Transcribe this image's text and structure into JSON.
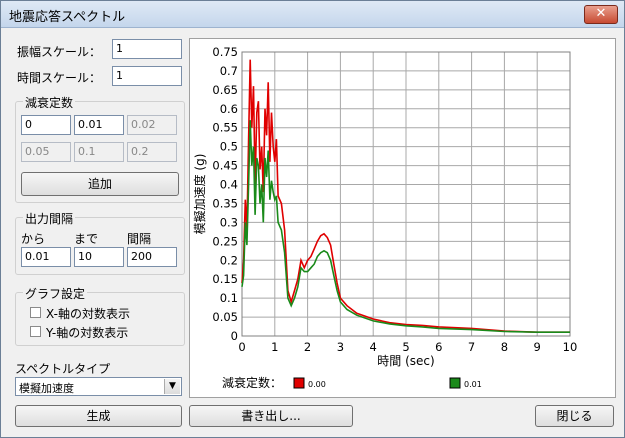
{
  "window": {
    "title": "地震応答スペクトル",
    "close_glyph": "✕"
  },
  "fields": {
    "amp_scale_label": "振幅スケール：",
    "amp_scale_value": "1",
    "time_scale_label": "時間スケール：",
    "time_scale_value": "1"
  },
  "damping": {
    "group_label": "減衰定数",
    "values": [
      "0",
      "0.01",
      "0.02",
      "0.05",
      "0.1",
      "0.2"
    ],
    "add_label": "追加"
  },
  "output": {
    "group_label": "出力間隔",
    "from_label": "から",
    "to_label": "まで",
    "interval_label": "間隔",
    "from_value": "0.01",
    "to_value": "10",
    "interval_value": "200"
  },
  "graph": {
    "group_label": "グラフ設定",
    "x_log_label": "X-軸の対数表示",
    "y_log_label": "Y-軸の対数表示"
  },
  "spectrum": {
    "type_label": "スペクトルタイプ",
    "type_value": "模擬加速度"
  },
  "buttons": {
    "generate": "生成",
    "export": "書き出し...",
    "close": "閉じる"
  },
  "legend": {
    "label": "減衰定数："
  },
  "colors": {
    "series_red": "#e00000",
    "series_green": "#1a8a1a",
    "grid": "#a8a8a8"
  },
  "chart_data": {
    "type": "line",
    "xlabel": "時間 (sec)",
    "ylabel": "模擬加速度 (g)",
    "xlim": [
      0,
      10
    ],
    "ylim": [
      0,
      0.75
    ],
    "x_ticks": [
      "0",
      "1",
      "2",
      "3",
      "4",
      "5",
      "6",
      "7",
      "8",
      "9",
      "10"
    ],
    "y_ticks": [
      "0",
      "0.05",
      "0.1",
      "0.15",
      "0.2",
      "0.25",
      "0.3",
      "0.35",
      "0.4",
      "0.45",
      "0.5",
      "0.55",
      "0.6",
      "0.65",
      "0.7",
      "0.75"
    ],
    "grid": true,
    "series": [
      {
        "name": "0.00",
        "color": "#e00000",
        "x": [
          0.0,
          0.05,
          0.1,
          0.15,
          0.2,
          0.25,
          0.3,
          0.35,
          0.4,
          0.45,
          0.5,
          0.55,
          0.6,
          0.65,
          0.7,
          0.75,
          0.8,
          0.85,
          0.9,
          0.95,
          1.0,
          1.05,
          1.1,
          1.2,
          1.3,
          1.4,
          1.5,
          1.6,
          1.7,
          1.8,
          1.9,
          2.0,
          2.1,
          2.2,
          2.3,
          2.4,
          2.5,
          2.6,
          2.7,
          2.8,
          2.9,
          3.0,
          3.2,
          3.5,
          4.0,
          4.5,
          5.0,
          5.5,
          6.0,
          7.0,
          8.0,
          9.0,
          10.0
        ],
        "values": [
          0.14,
          0.2,
          0.36,
          0.28,
          0.52,
          0.73,
          0.55,
          0.66,
          0.4,
          0.59,
          0.62,
          0.44,
          0.5,
          0.38,
          0.6,
          0.53,
          0.67,
          0.46,
          0.59,
          0.5,
          0.46,
          0.52,
          0.37,
          0.35,
          0.28,
          0.12,
          0.09,
          0.12,
          0.15,
          0.2,
          0.18,
          0.2,
          0.21,
          0.23,
          0.25,
          0.265,
          0.27,
          0.26,
          0.24,
          0.19,
          0.14,
          0.1,
          0.08,
          0.06,
          0.045,
          0.035,
          0.03,
          0.028,
          0.024,
          0.02,
          0.013,
          0.01,
          0.01
        ]
      },
      {
        "name": "0.01",
        "color": "#1a8a1a",
        "x": [
          0.0,
          0.05,
          0.1,
          0.15,
          0.2,
          0.25,
          0.3,
          0.35,
          0.4,
          0.45,
          0.5,
          0.55,
          0.6,
          0.65,
          0.7,
          0.75,
          0.8,
          0.85,
          0.9,
          0.95,
          1.0,
          1.05,
          1.1,
          1.2,
          1.3,
          1.4,
          1.5,
          1.6,
          1.7,
          1.8,
          1.9,
          2.0,
          2.1,
          2.2,
          2.3,
          2.4,
          2.5,
          2.6,
          2.7,
          2.8,
          2.9,
          3.0,
          3.2,
          3.5,
          4.0,
          4.5,
          5.0,
          5.5,
          6.0,
          7.0,
          8.0,
          9.0,
          10.0
        ],
        "values": [
          0.13,
          0.16,
          0.3,
          0.24,
          0.4,
          0.57,
          0.45,
          0.5,
          0.32,
          0.47,
          0.45,
          0.35,
          0.4,
          0.3,
          0.47,
          0.42,
          0.49,
          0.36,
          0.41,
          0.38,
          0.36,
          0.37,
          0.3,
          0.28,
          0.22,
          0.1,
          0.08,
          0.1,
          0.13,
          0.18,
          0.17,
          0.17,
          0.18,
          0.19,
          0.21,
          0.22,
          0.225,
          0.22,
          0.2,
          0.16,
          0.12,
          0.09,
          0.07,
          0.055,
          0.04,
          0.032,
          0.027,
          0.024,
          0.02,
          0.017,
          0.012,
          0.01,
          0.01
        ]
      }
    ]
  }
}
